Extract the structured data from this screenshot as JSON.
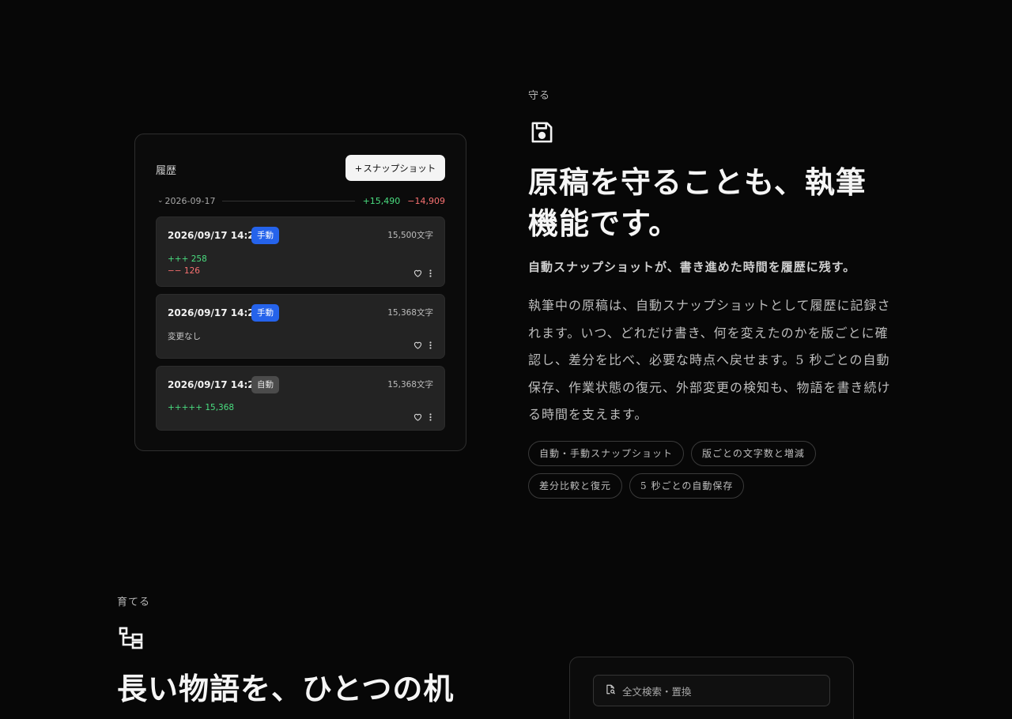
{
  "history": {
    "title": "履歴",
    "snapshot_button": "スナップショット",
    "snapshot_button_prefix": "+",
    "date_group": {
      "date": "2026-09-17",
      "added": "+15,490",
      "removed": "−14,909"
    },
    "snapshots": [
      {
        "time": "2026/09/17 14:23",
        "badge": "手動",
        "badge_kind": "manual",
        "count": "15,500文字",
        "added": "+++ 258",
        "removed": "−− 126"
      },
      {
        "time": "2026/09/17 14:20",
        "badge": "手動",
        "badge_kind": "manual",
        "count": "15,368文字",
        "note": "変更なし"
      },
      {
        "time": "2026/09/17 14:20",
        "badge": "自動",
        "badge_kind": "auto",
        "count": "15,368文字",
        "added": "+++++ 15,368"
      }
    ]
  },
  "protect": {
    "eyebrow": "守る",
    "icon": "save-icon",
    "headline_line1": "原稿を守ることも、執筆",
    "headline_line2": "機能です。",
    "subhead": "自動スナップショットが、書き進めた時間を履歴に残す。",
    "body": "執筆中の原稿は、自動スナップショットとして履歴に記録されます。いつ、どれだけ書き、何を変えたのかを版ごとに確認し、差分を比べ、必要な時点へ戻せます。5 秒ごとの自動保存、作業状態の復元、外部変更の検知も、物語を書き続ける時間を支えます。",
    "tags": [
      "自動・手動スナップショット",
      "版ごとの文字数と増減",
      "差分比較と復元",
      "5 秒ごとの自動保存"
    ]
  },
  "grow": {
    "eyebrow": "育てる",
    "icon": "structure-icon",
    "headline": "長い物語を、ひとつの机"
  },
  "search": {
    "icon": "file-search-icon",
    "placeholder": "全文検索・置換"
  },
  "colors": {
    "background": "#070707",
    "added": "#4ade80",
    "removed": "#f87171",
    "manual_badge": "#2563eb",
    "auto_badge": "#4b4b4b"
  }
}
